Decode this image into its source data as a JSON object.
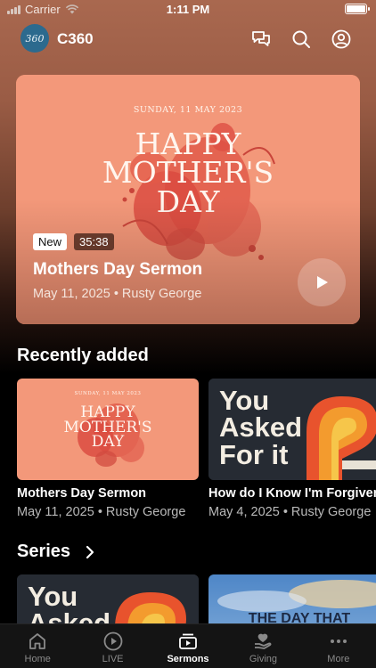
{
  "status": {
    "carrier": "Carrier",
    "time": "1:11 PM"
  },
  "header": {
    "logo_text": "360",
    "title": "C360"
  },
  "hero": {
    "art_date": "SUNDAY, 11 MAY 2023",
    "art_title_lines": [
      "HAPPY",
      "MOTHER'S",
      "DAY"
    ],
    "badge_new": "New",
    "duration": "35:38",
    "title": "Mothers Day Sermon",
    "meta": "May 11, 2025 • Rusty George"
  },
  "recently_added": {
    "title": "Recently added",
    "items": [
      {
        "art_date": "SUNDAY, 11 MAY 2023",
        "art_title_lines": [
          "HAPPY",
          "MOTHER'S",
          "DAY"
        ],
        "title": "Mothers Day Sermon",
        "meta": "May 11, 2025 • Rusty George"
      },
      {
        "art_title_lines": [
          "You",
          "Asked",
          "For it"
        ],
        "title": "How do I Know I'm Forgiven",
        "meta": "May 4, 2025 • Rusty George"
      }
    ]
  },
  "series": {
    "title": "Series",
    "items": [
      {
        "art_title_lines": [
          "You",
          "Asked"
        ]
      },
      {
        "art_title": "THE DAY THAT"
      }
    ]
  },
  "tabs": [
    {
      "label": "Home",
      "icon": "home-icon",
      "active": false
    },
    {
      "label": "LIVE",
      "icon": "play-circle-icon",
      "active": false
    },
    {
      "label": "Sermons",
      "icon": "sermons-icon",
      "active": true
    },
    {
      "label": "Giving",
      "icon": "giving-icon",
      "active": false
    },
    {
      "label": "More",
      "icon": "more-icon",
      "active": false
    }
  ],
  "colors": {
    "accent_orange": "#f09677",
    "logo_blue": "#2c6a8e",
    "tab_bar": "#141414"
  }
}
